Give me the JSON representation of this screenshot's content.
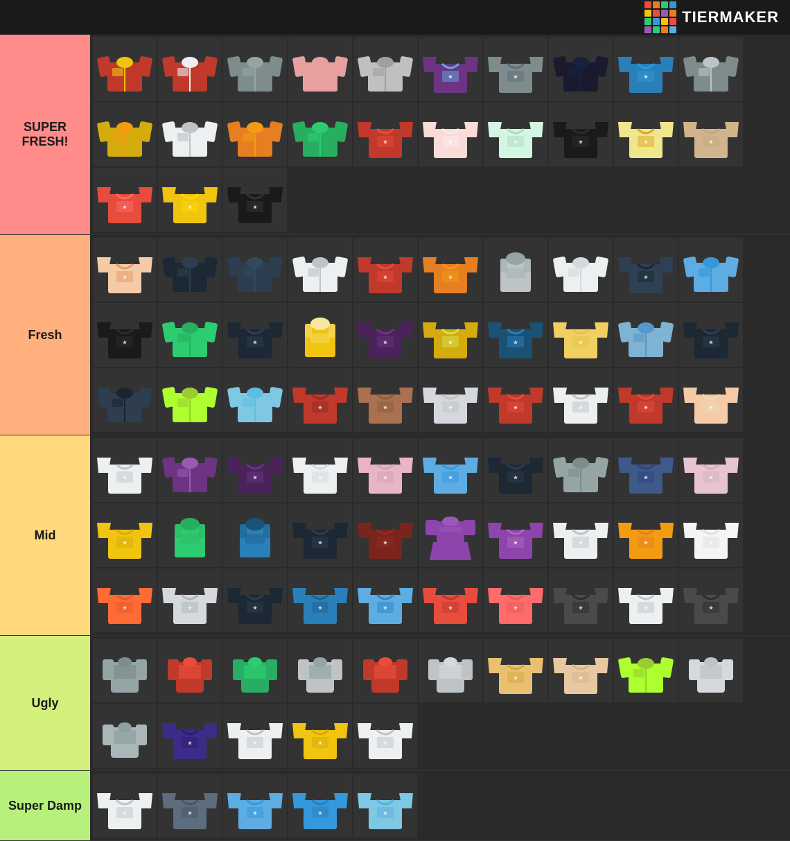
{
  "header": {
    "logo_text": "TiERMAKER",
    "logo_colors": [
      "#e74c3c",
      "#e67e22",
      "#f1c40f",
      "#2ecc71",
      "#3498db",
      "#9b59b6",
      "#e74c3c",
      "#e67e22",
      "#f1c40f",
      "#2ecc71",
      "#3498db",
      "#9b59b6",
      "#e74c3c",
      "#e67e22",
      "#f1c40f",
      "#2ecc71"
    ]
  },
  "tiers": [
    {
      "id": "super-fresh",
      "label": "SUPER FRESH!",
      "color": "#ff8b8b",
      "item_count": 23,
      "items": [
        {
          "id": 1,
          "color": "#c0392b",
          "accent": "#f1c40f",
          "type": "striped-jacket"
        },
        {
          "id": 2,
          "color": "#c0392b",
          "accent": "#ecf0f1",
          "type": "hoodie"
        },
        {
          "id": 3,
          "color": "#7f8c8d",
          "accent": "#95a5a6",
          "type": "parka"
        },
        {
          "id": 4,
          "color": "#e8a0a0",
          "accent": "#e8a0a0",
          "type": "jacket"
        },
        {
          "id": 5,
          "color": "#c0c0c0",
          "accent": "#a0a0a0",
          "type": "windbreaker"
        },
        {
          "id": 6,
          "color": "#6c3483",
          "accent": "#5dade2",
          "type": "graphic-tee"
        },
        {
          "id": 7,
          "color": "#7f8c8d",
          "accent": "#5d6d7e",
          "type": "dark-tee"
        },
        {
          "id": 8,
          "color": "#1a1a2e",
          "accent": "#16213e",
          "type": "black-jacket"
        },
        {
          "id": 9,
          "color": "#2980b9",
          "accent": "#3498db",
          "type": "blue-tee"
        },
        {
          "id": 10,
          "color": "#7f8c8d",
          "accent": "#bdc3c7",
          "type": "grey-hoodie"
        },
        {
          "id": 11,
          "color": "#d4ac0d",
          "accent": "#f39c12",
          "type": "yellow-jacket"
        },
        {
          "id": 12,
          "color": "#ecf0f1",
          "accent": "#bdc3c7",
          "type": "white-jacket"
        },
        {
          "id": 13,
          "color": "#e67e22",
          "accent": "#f39c12",
          "type": "colorful-jacket"
        },
        {
          "id": 14,
          "color": "#27ae60",
          "accent": "#2ecc71",
          "type": "patterned-jacket"
        },
        {
          "id": 15,
          "color": "#c0392b",
          "accent": "#e74c3c",
          "type": "red-graphic"
        },
        {
          "id": 16,
          "color": "#fadbd8",
          "accent": "#f9ebea",
          "type": "pink-tee"
        },
        {
          "id": 17,
          "color": "#d5f5e3",
          "accent": "#a9dfbf",
          "type": "light-green"
        },
        {
          "id": 18,
          "color": "#1a1a1a",
          "accent": "#2c2c2c",
          "type": "black-tee"
        },
        {
          "id": 19,
          "color": "#f0e68c",
          "accent": "#daa520",
          "type": "yellow-tee"
        },
        {
          "id": 20,
          "color": "#d2b48c",
          "accent": "#c4a882",
          "type": "tan-tee"
        },
        {
          "id": 21,
          "color": "#e74c3c",
          "accent": "#ff6b6b",
          "type": "red-tee"
        },
        {
          "id": 22,
          "color": "#f1c40f",
          "accent": "#ffd700",
          "type": "yellow2"
        },
        {
          "id": 23,
          "color": "#1a1a1a",
          "accent": "#333",
          "type": "black2"
        }
      ]
    },
    {
      "id": "fresh",
      "label": "Fresh",
      "color": "#ffb07c",
      "item_count": 30,
      "items": [
        {
          "id": 1,
          "color": "#f5cba7",
          "accent": "#e59866",
          "type": "floral"
        },
        {
          "id": 2,
          "color": "#1c2833",
          "accent": "#2c3e50",
          "type": "dark-hoodie"
        },
        {
          "id": 3,
          "color": "#2c3e50",
          "accent": "#34495e",
          "type": "dark-jacket"
        },
        {
          "id": 4,
          "color": "#ecf0f1",
          "accent": "#bdc3c7",
          "type": "white-coat"
        },
        {
          "id": 5,
          "color": "#c0392b",
          "accent": "#e74c3c",
          "type": "red-plaid"
        },
        {
          "id": 6,
          "color": "#e67e22",
          "accent": "#f39c12",
          "type": "colorful2"
        },
        {
          "id": 7,
          "color": "#bdc3c7",
          "accent": "#95a5a6",
          "type": "grey-vest"
        },
        {
          "id": 8,
          "color": "#ecf0f1",
          "accent": "#d5d8dc",
          "type": "white-hoodie"
        },
        {
          "id": 9,
          "color": "#2e4053",
          "accent": "#1a252f",
          "type": "dark2"
        },
        {
          "id": 10,
          "color": "#5dade2",
          "accent": "#3498db",
          "type": "blue-jacket"
        },
        {
          "id": 11,
          "color": "#1a1a1a",
          "accent": "#2c2c2c",
          "type": "black3"
        },
        {
          "id": 12,
          "color": "#2ecc71",
          "accent": "#27ae60",
          "type": "green-jacket"
        },
        {
          "id": 13,
          "color": "#1c2833",
          "accent": "#2c3e50",
          "type": "esrb-tee"
        },
        {
          "id": 14,
          "color": "#f1c40f",
          "accent": "#f9e79f",
          "type": "safety-vest"
        },
        {
          "id": 15,
          "color": "#4a235a",
          "accent": "#6c3483",
          "type": "purple-shirt"
        },
        {
          "id": 16,
          "color": "#d4ac0d",
          "accent": "#d4e157",
          "type": "yellow-shirt"
        },
        {
          "id": 17,
          "color": "#1a5276",
          "accent": "#2980b9",
          "type": "blue-shirt"
        },
        {
          "id": 18,
          "color": "#f0d060",
          "accent": "#e8c050",
          "type": "yellow-graphic"
        },
        {
          "id": 19,
          "color": "#7fb3d3",
          "accent": "#5499c9",
          "type": "teal-hoodie"
        },
        {
          "id": 20,
          "color": "#1c2833",
          "accent": "#2c3e50",
          "type": "dark-print"
        },
        {
          "id": 21,
          "color": "#2c3e50",
          "accent": "#1a252f",
          "type": "dark-hoodie2"
        },
        {
          "id": 22,
          "color": "#adff2f",
          "accent": "#9acd32",
          "type": "lime-jacket"
        },
        {
          "id": 23,
          "color": "#7ec8e3",
          "accent": "#5bc0de",
          "type": "cyan-jacket"
        },
        {
          "id": 24,
          "color": "#c0392b",
          "accent": "#922b21",
          "type": "red-striped"
        },
        {
          "id": 25,
          "color": "#a9714f",
          "accent": "#8b5e3c",
          "type": "tan-plaid"
        },
        {
          "id": 26,
          "color": "#d5d8dc",
          "accent": "#bdc3c7",
          "type": "grey-shirt"
        },
        {
          "id": 27,
          "color": "#c0392b",
          "accent": "#e74c3c",
          "type": "red-shirt"
        },
        {
          "id": 28,
          "color": "#ecf0f1",
          "accent": "#bdc3c7",
          "type": "white-shirt2"
        },
        {
          "id": 29,
          "color": "#c0392b",
          "accent": "#e74c3c",
          "type": "heart-shirt"
        },
        {
          "id": 30,
          "color": "#f5cba7",
          "accent": "#f0d9b5",
          "type": "cream-shirt"
        }
      ]
    },
    {
      "id": "mid",
      "label": "Mid",
      "color": "#ffd97c",
      "item_count": 30,
      "items": [
        {
          "id": 1,
          "color": "#ecf0f1",
          "accent": "#bdc3c7",
          "type": "white-collar"
        },
        {
          "id": 2,
          "color": "#6c3483",
          "accent": "#9b59b6",
          "type": "purple-hoodie"
        },
        {
          "id": 3,
          "color": "#4a235a",
          "accent": "#6c3483",
          "type": "dark-purple"
        },
        {
          "id": 4,
          "color": "#ecf0f1",
          "accent": "#d5d8dc",
          "type": "white-loose"
        },
        {
          "id": 5,
          "color": "#e8b4c8",
          "accent": "#d4a0b4",
          "type": "floral-pink"
        },
        {
          "id": 6,
          "color": "#5dade2",
          "accent": "#3498db",
          "type": "blue-pattern"
        },
        {
          "id": 7,
          "color": "#1c2833",
          "accent": "#2c3e50",
          "type": "black-leather"
        },
        {
          "id": 8,
          "color": "#95a5a6",
          "accent": "#7f8c8d",
          "type": "grey-hoodie2"
        },
        {
          "id": 9,
          "color": "#3d5a8a",
          "accent": "#2e4482",
          "type": "blue-print"
        },
        {
          "id": 10,
          "color": "#e8c4d0",
          "accent": "#d4b0bc",
          "type": "pink-knit"
        },
        {
          "id": 11,
          "color": "#f1c40f",
          "accent": "#d4ac0d",
          "type": "yellow3"
        },
        {
          "id": 12,
          "color": "#2ecc71",
          "accent": "#27ae60",
          "type": "green-vest"
        },
        {
          "id": 13,
          "color": "#2980b9",
          "accent": "#1a5276",
          "type": "blue-tank"
        },
        {
          "id": 14,
          "color": "#1c2833",
          "accent": "#2c3e50",
          "type": "dark-print2"
        },
        {
          "id": 15,
          "color": "#7b241c",
          "accent": "#922b21",
          "type": "brown-tee"
        },
        {
          "id": 16,
          "color": "#8e44ad",
          "accent": "#9b59b6",
          "type": "purple-dress"
        },
        {
          "id": 17,
          "color": "#8e44ad",
          "accent": "#a569bd",
          "type": "purple-tee"
        },
        {
          "id": 18,
          "color": "#ecf0f1",
          "accent": "#bdc3c7",
          "type": "white-stripe"
        },
        {
          "id": 19,
          "color": "#f39c12",
          "accent": "#e67e22",
          "type": "orange-shirt"
        },
        {
          "id": 20,
          "color": "#f5f5f5",
          "accent": "#e0e0e0",
          "type": "beige-shirt"
        },
        {
          "id": 21,
          "color": "#ff6b35",
          "accent": "#e55a2b",
          "type": "orange-stripe"
        },
        {
          "id": 22,
          "color": "#d5d8dc",
          "accent": "#aab7b8",
          "type": "light-grey"
        },
        {
          "id": 23,
          "color": "#1c2833",
          "accent": "#2c3e50",
          "type": "dark-symbol"
        },
        {
          "id": 24,
          "color": "#2980b9",
          "accent": "#1f618d",
          "type": "blue-tee2"
        },
        {
          "id": 25,
          "color": "#5dade2",
          "accent": "#2e86c1",
          "type": "light-blue"
        },
        {
          "id": 26,
          "color": "#e74c3c",
          "accent": "#c0392b",
          "type": "red-arrows"
        },
        {
          "id": 27,
          "color": "#ff6b6b",
          "accent": "#e55b5b",
          "type": "red-graphic2"
        },
        {
          "id": 28,
          "color": "#4a4a4a",
          "accent": "#2c2c2c",
          "type": "dark-print3"
        },
        {
          "id": 29,
          "color": "#ecf0f1",
          "accent": "#bdc3c7",
          "type": "white-brand"
        },
        {
          "id": 30,
          "color": "#4a4a4a",
          "accent": "#2c2c2c",
          "type": "dark-number"
        }
      ]
    },
    {
      "id": "ugly",
      "label": "Ugly",
      "color": "#d4f07c",
      "item_count": 15,
      "items": [
        {
          "id": 1,
          "color": "#95a5a6",
          "accent": "#7f8c8d",
          "type": "armor"
        },
        {
          "id": 2,
          "color": "#c0392b",
          "accent": "#e74c3c",
          "type": "red-armor"
        },
        {
          "id": 3,
          "color": "#27ae60",
          "accent": "#2ecc71",
          "type": "green-armor"
        },
        {
          "id": 4,
          "color": "#bdc3c7",
          "accent": "#95a5a6",
          "type": "silver-armor"
        },
        {
          "id": 5,
          "color": "#c0392b",
          "accent": "#e74c3c",
          "type": "red-mech"
        },
        {
          "id": 6,
          "color": "#bdc3c7",
          "accent": "#d5d8dc",
          "type": "silver-mech"
        },
        {
          "id": 7,
          "color": "#e8c070",
          "accent": "#d4a840",
          "type": "multicolor"
        },
        {
          "id": 8,
          "color": "#e8c8a0",
          "accent": "#d4b488",
          "type": "tan-outfit"
        },
        {
          "id": 9,
          "color": "#adff2f",
          "accent": "#9acd32",
          "type": "lime-jacket2"
        },
        {
          "id": 10,
          "color": "#d5d8dc",
          "accent": "#bdc3c7",
          "type": "white-mech"
        },
        {
          "id": 11,
          "color": "#aab7b8",
          "accent": "#8e9fa0",
          "type": "grey-mech"
        },
        {
          "id": 12,
          "color": "#3d2b8a",
          "accent": "#2e1e6b",
          "type": "purple-logo"
        },
        {
          "id": 13,
          "color": "#ecf0f1",
          "accent": "#bdc3c7",
          "type": "white-longsleeve"
        },
        {
          "id": 14,
          "color": "#f1c40f",
          "accent": "#d4ac0d",
          "type": "yellow-logo"
        },
        {
          "id": 15,
          "color": "#ecf0f1",
          "accent": "#bdc3c7",
          "type": "white-graphic"
        }
      ]
    },
    {
      "id": "super-damp",
      "label": "Super Damp",
      "color": "#b8f07c",
      "item_count": 5,
      "items": [
        {
          "id": 1,
          "color": "#ecf0f1",
          "accent": "#bdc3c7",
          "type": "white-blob"
        },
        {
          "id": 2,
          "color": "#5d6d7e",
          "accent": "#4a5568",
          "type": "grey-scarf"
        },
        {
          "id": 3,
          "color": "#5dade2",
          "accent": "#3498db",
          "type": "teal-tee"
        },
        {
          "id": 4,
          "color": "#3498db",
          "accent": "#2980b9",
          "type": "blue-print2"
        },
        {
          "id": 5,
          "color": "#7ec8e3",
          "accent": "#5dade2",
          "type": "pixel-tee"
        }
      ]
    }
  ]
}
